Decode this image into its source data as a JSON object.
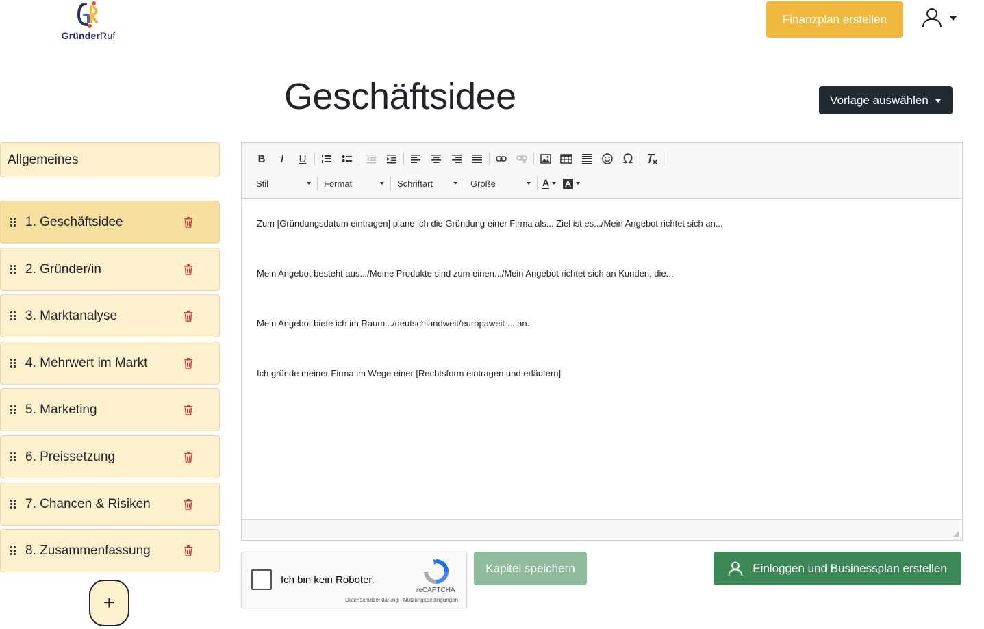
{
  "brand": {
    "logo_text_bold": "Gründer",
    "logo_text_light": "Ruf",
    "colors": {
      "accent": "#f0b93e",
      "dark": "#212b33",
      "green": "#3b8755",
      "chapter_bg": "#fdf0cc",
      "trash": "#e03a3a"
    }
  },
  "header": {
    "finanzplan_label": "Finanzplan erstellen",
    "user_icon": "user-icon"
  },
  "page": {
    "title": "Geschäftsidee",
    "vorlage_label": "Vorlage auswählen"
  },
  "sidebar": {
    "general_label": "Allgemeines",
    "chapters": [
      {
        "label": "1. Geschäftsidee"
      },
      {
        "label": "2. Gründer/in"
      },
      {
        "label": "3. Marktanalyse"
      },
      {
        "label": "4. Mehrwert im Markt"
      },
      {
        "label": "5. Marketing"
      },
      {
        "label": "6. Preissetzung"
      },
      {
        "label": "7. Chancen & Risiken"
      },
      {
        "label": "8. Zusammenfassung"
      }
    ],
    "add_label": "+"
  },
  "editor": {
    "toolbar": {
      "bold": "B",
      "italic": "I",
      "underline": "U",
      "special_char": "Ω",
      "styles": [
        "Stil",
        "Format",
        "Schriftart",
        "Größe"
      ],
      "text_color": "A"
    },
    "paragraphs": [
      "Zum [Gründungsdatum eintragen] plane ich die Gründung einer Firma als... Ziel ist es.../Mein Angebot richtet sich an...",
      "Mein Angebot besteht aus.../Meine Produkte sind zum einen.../Mein Angebot richtet sich an Kunden, die...",
      "Mein Angebot biete ich im Raum.../deutschlandweit/europaweit ... an.",
      "Ich gründe meiner Firma im Wege einer [Rechtsform eintragen und erläutern]"
    ]
  },
  "captcha": {
    "label": "Ich bin kein Roboter.",
    "brand": "reCAPTCHA",
    "links": "Datenschutzerklärung - Nutzungsbedingungen"
  },
  "actions": {
    "save_label": "Kapitel speichern",
    "login_label": "Einloggen und Businessplan erstellen"
  }
}
